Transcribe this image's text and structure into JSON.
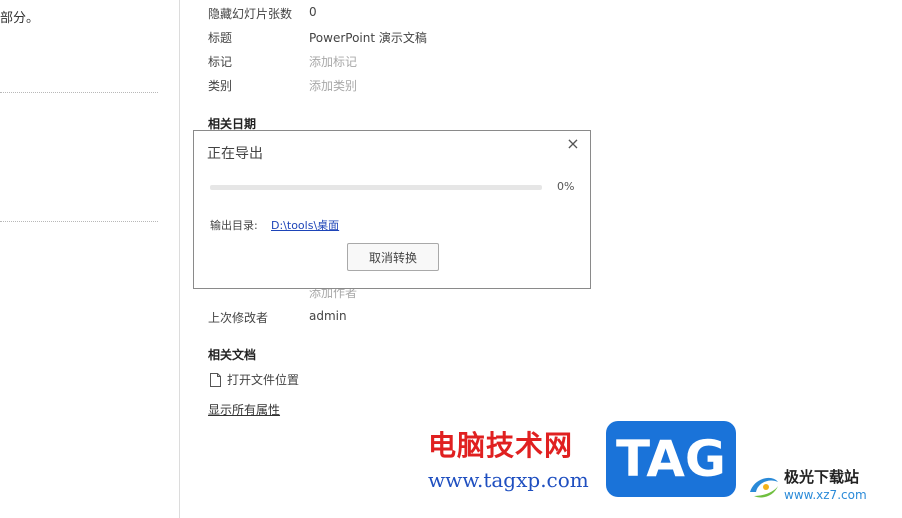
{
  "left_pane": {
    "snippet": "部分。"
  },
  "properties": {
    "hidden_slides": {
      "label": "隐藏幻灯片张数",
      "value": "0"
    },
    "title": {
      "label": "标题",
      "value": "PowerPoint 演示文稿"
    },
    "tags": {
      "label": "标记",
      "placeholder": "添加标记"
    },
    "category": {
      "label": "类别",
      "placeholder": "添加类别"
    }
  },
  "sections": {
    "related_dates": "相关日期",
    "related_people_partial": "添加作者",
    "last_modified_by": {
      "label": "上次修改者",
      "value": "admin"
    },
    "related_docs": "相关文档",
    "open_file_location": "打开文件位置",
    "show_all_properties": "显示所有属性"
  },
  "dialog": {
    "title": "正在导出",
    "close_symbol": "×",
    "progress_percent": 0,
    "progress_text": "0%",
    "output_dir_label": "输出目录:",
    "output_dir_value": "D:\\tools\\桌面",
    "cancel_label": "取消转换"
  },
  "watermarks": {
    "site_name": "电脑技术网",
    "site_url": "www.tagxp.com",
    "tag_logo": "TAG",
    "xz7_name": "极光下载站",
    "xz7_url": "www.xz7.com"
  },
  "colors": {
    "link_blue": "#1d44b8",
    "progress_blue": "#2e7bd8",
    "watermark_red": "#e02020",
    "tag_blue": "#1a73d9"
  },
  "icons": {
    "close": "close-icon",
    "file": "file-icon",
    "xz7": "xz7-swirl-logo"
  }
}
